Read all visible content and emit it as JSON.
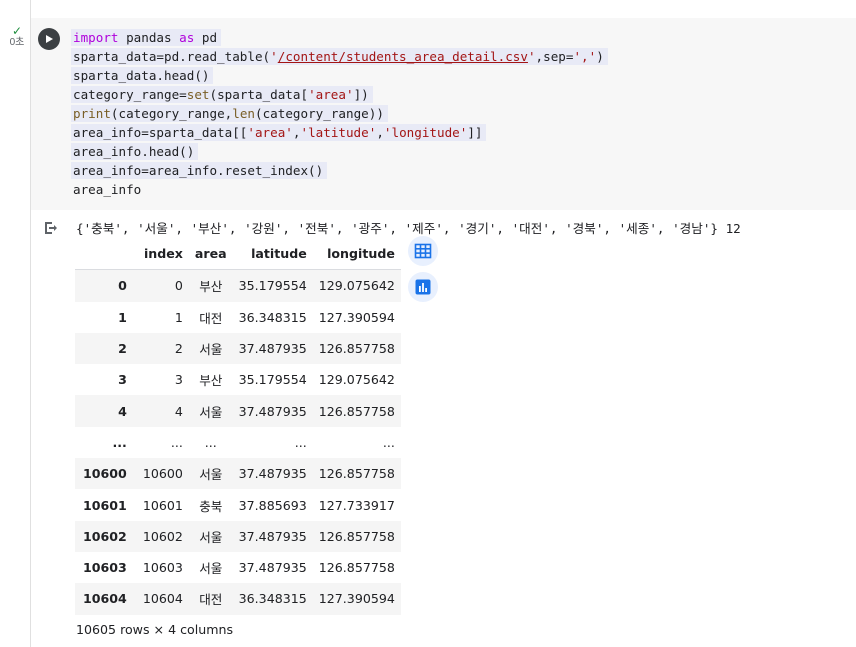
{
  "cell": {
    "exec_time": "0초",
    "code_lines": [
      "import pandas as pd",
      "sparta_data=pd.read_table('/content/students_area_detail.csv',sep=',')",
      "sparta_data.head()",
      "category_range=set(sparta_data['area'])",
      "print(category_range,len(category_range))",
      "area_info=sparta_data[['area','latitude','longitude']]",
      "area_info.head()",
      "area_info=area_info.reset_index()",
      "area_info"
    ]
  },
  "output": {
    "stdout": "{'충북', '서울', '부산', '강원', '전북', '광주', '제주', '경기', '대전', '경북', '세종', '경남'} 12",
    "columns": [
      "index",
      "area",
      "latitude",
      "longitude"
    ],
    "rows": [
      {
        "idx": "0",
        "index": "0",
        "area": "부산",
        "latitude": "35.179554",
        "longitude": "129.075642"
      },
      {
        "idx": "1",
        "index": "1",
        "area": "대전",
        "latitude": "36.348315",
        "longitude": "127.390594"
      },
      {
        "idx": "2",
        "index": "2",
        "area": "서울",
        "latitude": "37.487935",
        "longitude": "126.857758"
      },
      {
        "idx": "3",
        "index": "3",
        "area": "부산",
        "latitude": "35.179554",
        "longitude": "129.075642"
      },
      {
        "idx": "4",
        "index": "4",
        "area": "서울",
        "latitude": "37.487935",
        "longitude": "126.857758"
      },
      {
        "idx": "...",
        "index": "...",
        "area": "...",
        "latitude": "...",
        "longitude": "..."
      },
      {
        "idx": "10600",
        "index": "10600",
        "area": "서울",
        "latitude": "37.487935",
        "longitude": "126.857758"
      },
      {
        "idx": "10601",
        "index": "10601",
        "area": "충북",
        "latitude": "37.885693",
        "longitude": "127.733917"
      },
      {
        "idx": "10602",
        "index": "10602",
        "area": "서울",
        "latitude": "37.487935",
        "longitude": "126.857758"
      },
      {
        "idx": "10603",
        "index": "10603",
        "area": "서울",
        "latitude": "37.487935",
        "longitude": "126.857758"
      },
      {
        "idx": "10604",
        "index": "10604",
        "area": "대전",
        "latitude": "36.348315",
        "longitude": "127.390594"
      }
    ],
    "footer": "10605 rows × 4 columns"
  },
  "icons": {
    "run": "play-icon",
    "output": "output-arrow-icon",
    "table": "table-icon",
    "chart": "bar-chart-icon"
  },
  "colors": {
    "accent": "#1a73e8",
    "keyword": "#af00db",
    "builtin": "#795e26",
    "string": "#a31515"
  }
}
